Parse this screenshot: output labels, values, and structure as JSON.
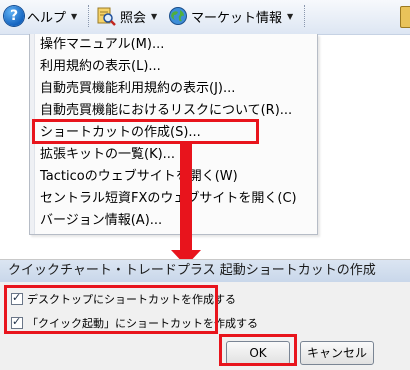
{
  "menubar": {
    "help": "ヘルプ",
    "inquiry": "照会",
    "market": "マーケット情報"
  },
  "help_menu": {
    "items": [
      "操作マニュアル(M)...",
      "利用規約の表示(L)...",
      "自動売買機能利用規約の表示(J)...",
      "自動売買機能におけるリスクについて(R)...",
      "ショートカットの作成(S)...",
      "拡張キットの一覧(K)...",
      "Tacticoのウェブサイトを開く(W)",
      "セントラル短資FXのウェブサイトを開く(C)",
      "バージョン情報(A)..."
    ],
    "highlighted_index": 4
  },
  "dialog": {
    "title": "クイックチャート・トレードプラス 起動ショートカットの作成",
    "options": [
      {
        "label": "デスクトップにショートカットを作成する",
        "checked": true
      },
      {
        "label": "「クイック起動」にショートカットを作成する",
        "checked": true
      }
    ],
    "ok": "OK",
    "cancel": "キャンセル"
  },
  "colors": {
    "highlight": "#e8141c",
    "accent": "#1564c0"
  },
  "icons": [
    "help-icon",
    "inquiry-icon",
    "globe-icon",
    "chevron-down-icon",
    "checkmark-icon",
    "arrow-down-icon"
  ]
}
